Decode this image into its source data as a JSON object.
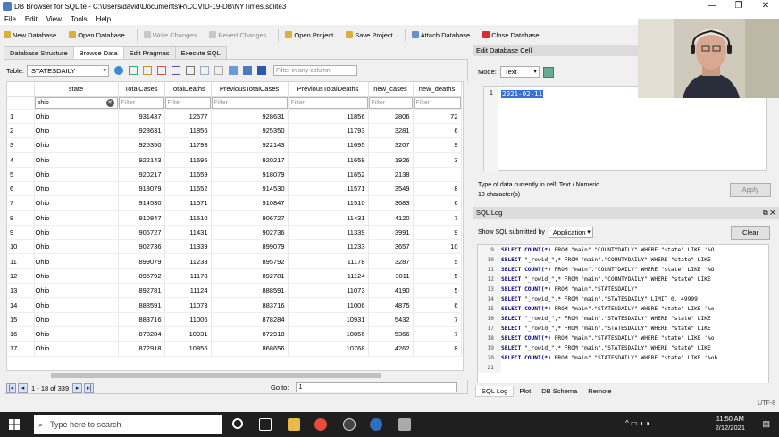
{
  "window": {
    "title": "DB Browser for SQLite - C:\\Users\\david\\Documents\\R\\COVID-19-DB\\NYTimes.sqlite3",
    "btn_min": "—",
    "btn_max": "❐",
    "btn_close": "✕"
  },
  "menu": [
    "File",
    "Edit",
    "View",
    "Tools",
    "Help"
  ],
  "toolbar": [
    {
      "label": "New Database",
      "icon": "new-database-icon",
      "enabled": true,
      "color": "#d8b040"
    },
    {
      "label": "Open Database",
      "icon": "open-database-icon",
      "enabled": true,
      "color": "#d8b040"
    },
    {
      "label": "Write Changes",
      "icon": "write-changes-icon",
      "enabled": false,
      "color": "#c8c8c8"
    },
    {
      "label": "Revert Changes",
      "icon": "revert-changes-icon",
      "enabled": false,
      "color": "#c8c8c8"
    },
    {
      "label": "Open Project",
      "icon": "open-project-icon",
      "enabled": true,
      "color": "#d8b040"
    },
    {
      "label": "Save Project",
      "icon": "save-project-icon",
      "enabled": true,
      "color": "#d8b040"
    },
    {
      "label": "Attach Database",
      "icon": "attach-database-icon",
      "enabled": true,
      "color": "#6b8fc7"
    },
    {
      "label": "Close Database",
      "icon": "close-database-icon",
      "enabled": true,
      "color": "#d03030"
    }
  ],
  "tabs": [
    {
      "label": "Database Structure",
      "active": false
    },
    {
      "label": "Browse Data",
      "active": true
    },
    {
      "label": "Edit Pragmas",
      "active": false
    },
    {
      "label": "Execute SQL",
      "active": false
    }
  ],
  "browse": {
    "table_label": "Table:",
    "table_selected": "STATESDAILY",
    "filter_all_placeholder": "Filter in any column",
    "columns": [
      "state",
      "TotalCases",
      "TotalDeaths",
      "PreviousTotalCases",
      "PreviousTotalDeaths",
      "new_cases",
      "new_deaths"
    ],
    "filter_placeholder": "Filter",
    "state_filter_value": "ohio",
    "clear_glyph": "✕",
    "rows": [
      [
        "1",
        "Ohio",
        "931437",
        "12577",
        "928631",
        "11856",
        "2806",
        "72"
      ],
      [
        "2",
        "Ohio",
        "928631",
        "11856",
        "925350",
        "11793",
        "3281",
        "6"
      ],
      [
        "3",
        "Ohio",
        "925350",
        "11793",
        "922143",
        "11695",
        "3207",
        "9"
      ],
      [
        "4",
        "Ohio",
        "922143",
        "11695",
        "920217",
        "11659",
        "1926",
        "3"
      ],
      [
        "5",
        "Ohio",
        "920217",
        "11659",
        "918079",
        "11652",
        "2138",
        ""
      ],
      [
        "6",
        "Ohio",
        "918079",
        "11652",
        "914530",
        "11571",
        "3549",
        "8"
      ],
      [
        "7",
        "Ohio",
        "914530",
        "11571",
        "910847",
        "11510",
        "3683",
        "6"
      ],
      [
        "8",
        "Ohio",
        "910847",
        "11510",
        "906727",
        "11431",
        "4120",
        "7"
      ],
      [
        "9",
        "Ohio",
        "906727",
        "11431",
        "902736",
        "11339",
        "3991",
        "9"
      ],
      [
        "10",
        "Ohio",
        "902736",
        "11339",
        "899079",
        "11233",
        "3657",
        "10"
      ],
      [
        "11",
        "Ohio",
        "899079",
        "11233",
        "895792",
        "11178",
        "3287",
        "5"
      ],
      [
        "12",
        "Ohio",
        "895792",
        "11178",
        "892781",
        "11124",
        "3011",
        "5"
      ],
      [
        "13",
        "Ohio",
        "892781",
        "11124",
        "888591",
        "11073",
        "4190",
        "5"
      ],
      [
        "14",
        "Ohio",
        "888591",
        "11073",
        "883716",
        "11006",
        "4875",
        "6"
      ],
      [
        "15",
        "Ohio",
        "883716",
        "11006",
        "878284",
        "10931",
        "5432",
        "7"
      ],
      [
        "16",
        "Ohio",
        "878284",
        "10931",
        "872918",
        "10856",
        "5366",
        "7"
      ],
      [
        "17",
        "Ohio",
        "872918",
        "10856",
        "868656",
        "10768",
        "4262",
        "8"
      ]
    ],
    "pagination": "1 - 18 of 339",
    "goto_label": "Go to:",
    "goto_value": "1"
  },
  "edit_cell": {
    "title": "Edit Database Cell",
    "mode_label": "Mode:",
    "mode_value": "Text",
    "line_no": "1",
    "value": "2021-02-11",
    "type_info": "Type of data currently in cell: Text / Numeric",
    "chars": "10 character(s)",
    "apply": "Apply"
  },
  "sql_log": {
    "title": "SQL Log",
    "submitted_label": "Show SQL submitted by",
    "submitted_value": "Application",
    "clear": "Clear",
    "lines": [
      {
        "n": "9",
        "kw": "SELECT COUNT(*)",
        "rest": " FROM \"main\".\"COUNTYDAILY\" WHERE \"state\" LIKE '%O"
      },
      {
        "n": "10",
        "kw": "SELECT",
        "rest": " \"_rowid_\",* FROM \"main\".\"COUNTYDAILY\" WHERE \"state\" LIKE"
      },
      {
        "n": "11",
        "kw": "SELECT COUNT(*)",
        "rest": " FROM \"main\".\"COUNTYDAILY\" WHERE \"state\" LIKE '%O"
      },
      {
        "n": "12",
        "kw": "SELECT",
        "rest": " \"_rowid_\",* FROM \"main\".\"COUNTYDAILY\" WHERE \"state\" LIKE"
      },
      {
        "n": "13",
        "kw": "SELECT COUNT(*)",
        "rest": " FROM \"main\".\"STATESDAILY\""
      },
      {
        "n": "14",
        "kw": "SELECT",
        "rest": " \"_rowid_\",* FROM \"main\".\"STATESDAILY\" LIMIT 0, 49999;"
      },
      {
        "n": "15",
        "kw": "SELECT COUNT(*)",
        "rest": " FROM \"main\".\"STATESDAILY\" WHERE \"state\" LIKE '%o"
      },
      {
        "n": "16",
        "kw": "SELECT",
        "rest": " \"_rowid_\",* FROM \"main\".\"STATESDAILY\" WHERE \"state\" LIKE"
      },
      {
        "n": "17",
        "kw": "SELECT",
        "rest": " \"_rowid_\",* FROM \"main\".\"STATESDAILY\" WHERE \"state\" LIKE"
      },
      {
        "n": "18",
        "kw": "SELECT COUNT(*)",
        "rest": " FROM \"main\".\"STATESDAILY\" WHERE \"state\" LIKE '%o"
      },
      {
        "n": "19",
        "kw": "SELECT",
        "rest": " \"_rowid_\",* FROM \"main\".\"STATESDAILY\" WHERE \"state\" LIKE"
      },
      {
        "n": "20",
        "kw": "SELECT COUNT(*)",
        "rest": " FROM \"main\".\"STATESDAILY\" WHERE \"state\" LIKE '%oh"
      },
      {
        "n": "21",
        "kw": "",
        "rest": ""
      }
    ],
    "bottom_tabs": [
      {
        "label": "SQL Log",
        "active": true
      },
      {
        "label": "Plot",
        "active": false
      },
      {
        "label": "DB Schema",
        "active": false
      },
      {
        "label": "Remote",
        "active": false
      }
    ]
  },
  "status": {
    "encoding": "UTF-8"
  },
  "taskbar": {
    "search_placeholder": "Type here to search",
    "time": "11:50 AM",
    "date": "2/12/2021"
  }
}
